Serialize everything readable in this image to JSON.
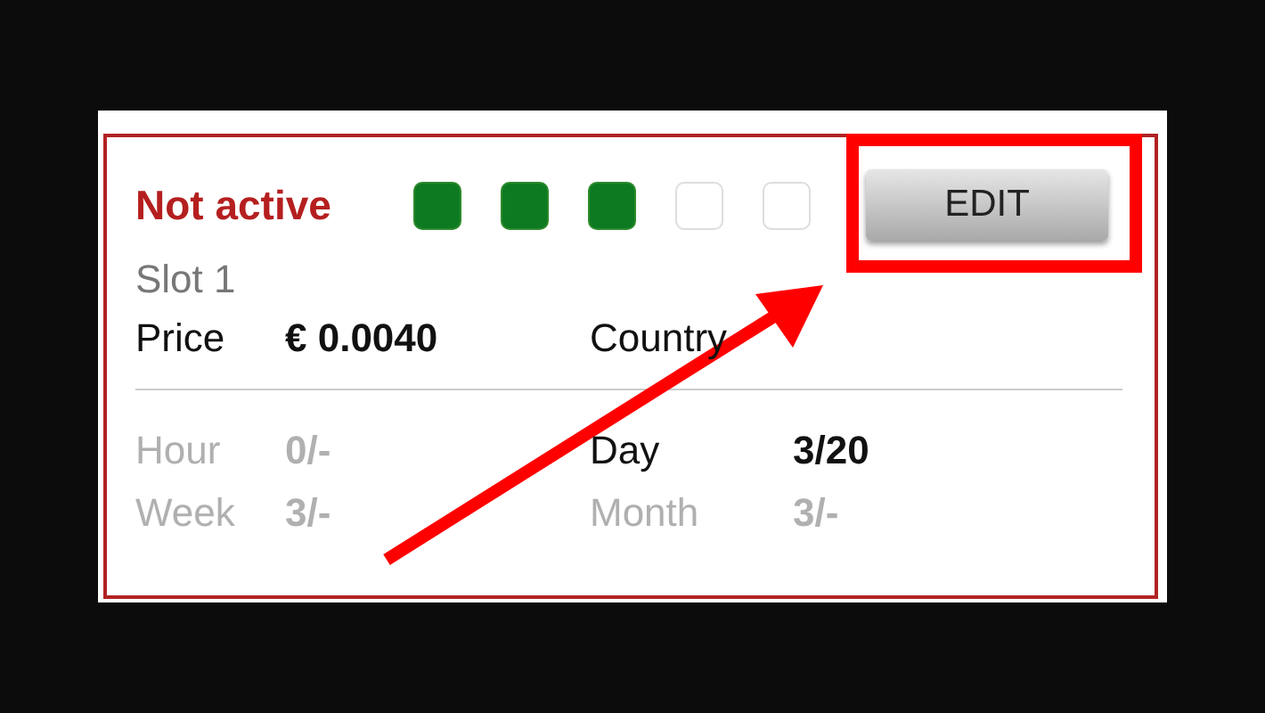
{
  "status": {
    "label": "Not active",
    "active": false
  },
  "slots": [
    {
      "filled": true
    },
    {
      "filled": true
    },
    {
      "filled": true
    },
    {
      "filled": false
    },
    {
      "filled": false
    }
  ],
  "edit_button": {
    "label": "EDIT"
  },
  "slot_name": "Slot 1",
  "price": {
    "label": "Price",
    "value": "€ 0.0040"
  },
  "country": {
    "label": "Country"
  },
  "stats": [
    {
      "label": "Hour",
      "value": "0/-",
      "emphasized": false
    },
    {
      "label": "Day",
      "value": "3/20",
      "emphasized": true
    },
    {
      "label": "Week",
      "value": "3/-",
      "emphasized": false
    },
    {
      "label": "Month",
      "value": "3/-",
      "emphasized": false
    }
  ]
}
